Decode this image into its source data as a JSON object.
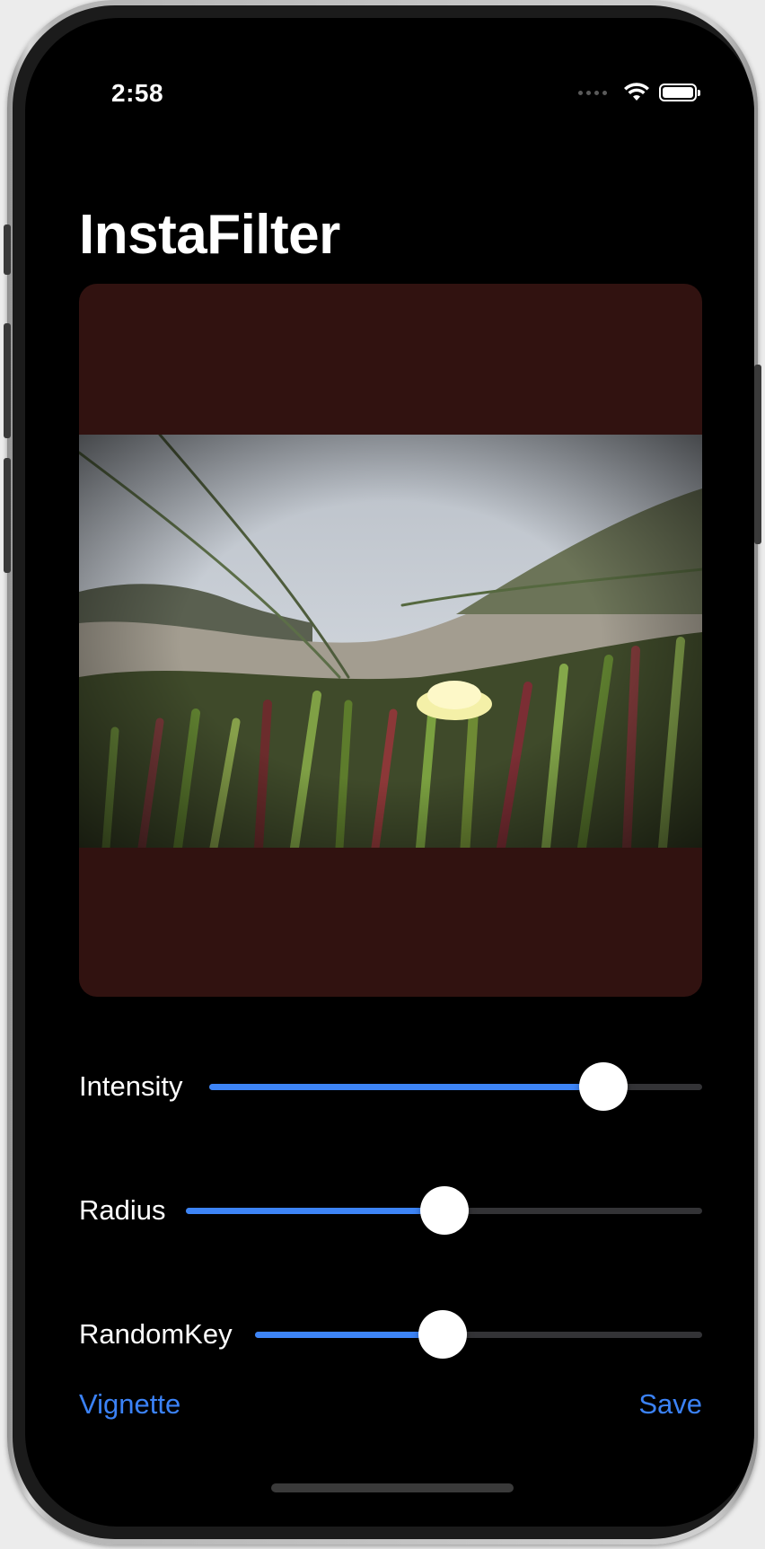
{
  "status_bar": {
    "time": "2:58"
  },
  "app": {
    "title": "InstaFilter"
  },
  "image": {
    "description_icon": "photo-icon"
  },
  "sliders": [
    {
      "label": "Intensity",
      "value": 0.8
    },
    {
      "label": "Radius",
      "value": 0.5
    },
    {
      "label": "RandomKey",
      "value": 0.42
    }
  ],
  "toolbar": {
    "filter_label": "Vignette",
    "save_label": "Save"
  },
  "colors": {
    "accent": "#3d84f6",
    "background": "#000000",
    "image_panel": "#311210",
    "track": "#333336"
  }
}
